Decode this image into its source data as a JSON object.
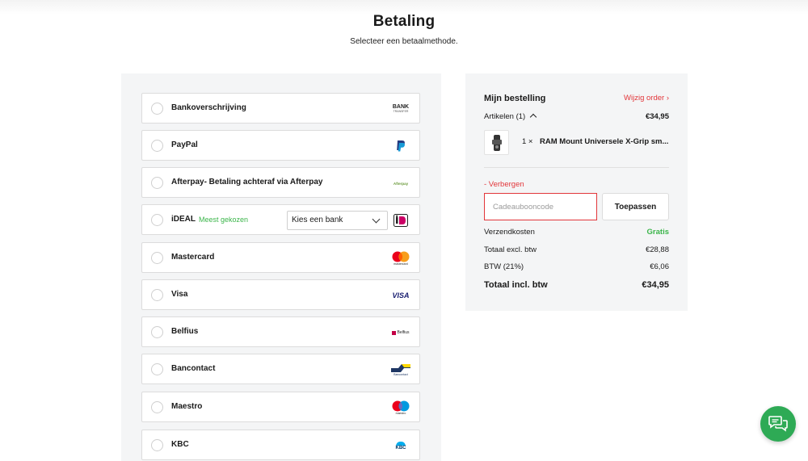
{
  "header": {
    "title": "Betaling",
    "subtitle": "Selecteer een betaalmethode."
  },
  "payment_methods": [
    {
      "label": "Bankoverschrijving",
      "logo": "bank-transfer-logo",
      "logo_text": "BANK",
      "logo_subtext": "TRANSFER"
    },
    {
      "label": "PayPal",
      "logo": "paypal-logo"
    },
    {
      "label": "Afterpay- Betaling achteraf via Afterpay",
      "logo": "afterpay-logo",
      "logo_text": "Afterpay"
    },
    {
      "label": "iDEAL",
      "badge": "Meest gekozen",
      "select_value": "Kies een bank",
      "logo": "ideal-logo"
    },
    {
      "label": "Mastercard",
      "logo": "mastercard-logo",
      "logo_text": "mastercard"
    },
    {
      "label": "Visa",
      "logo": "visa-logo",
      "logo_text": "VISA"
    },
    {
      "label": "Belfius",
      "logo": "belfius-logo",
      "logo_text": "Belfius"
    },
    {
      "label": "Bancontact",
      "logo": "bancontact-logo",
      "logo_text": "Bancontact"
    },
    {
      "label": "Maestro",
      "logo": "maestro-logo",
      "logo_text": "maestro"
    },
    {
      "label": "KBC",
      "logo": "kbc-logo",
      "logo_text": "KBC"
    }
  ],
  "order": {
    "title": "Mijn bestelling",
    "change_link": "Wijzig order ›",
    "items_label": "Artikelen (1)",
    "items_total": "€34,95",
    "product": {
      "qty": "1 ×",
      "name": "RAM Mount Universele X-Grip sm..."
    },
    "hide_link": "- Verbergen",
    "coupon_placeholder": "Cadeaubooncode",
    "apply_label": "Toepassen",
    "summary": [
      {
        "label": "Verzendkosten",
        "value": "Gratis"
      },
      {
        "label": "Totaal excl. btw",
        "value": "€28,88"
      },
      {
        "label": "BTW (21%)",
        "value": "€6,06"
      },
      {
        "label": "Totaal incl. btw",
        "value": "€34,95"
      }
    ]
  },
  "colors": {
    "accent_red": "#e2363a",
    "accent_green": "#3bb54a",
    "chat_green": "#2eaa55",
    "panel_bg": "#f4f5f6"
  },
  "chat": {
    "icon": "chat-bubbles-icon"
  }
}
